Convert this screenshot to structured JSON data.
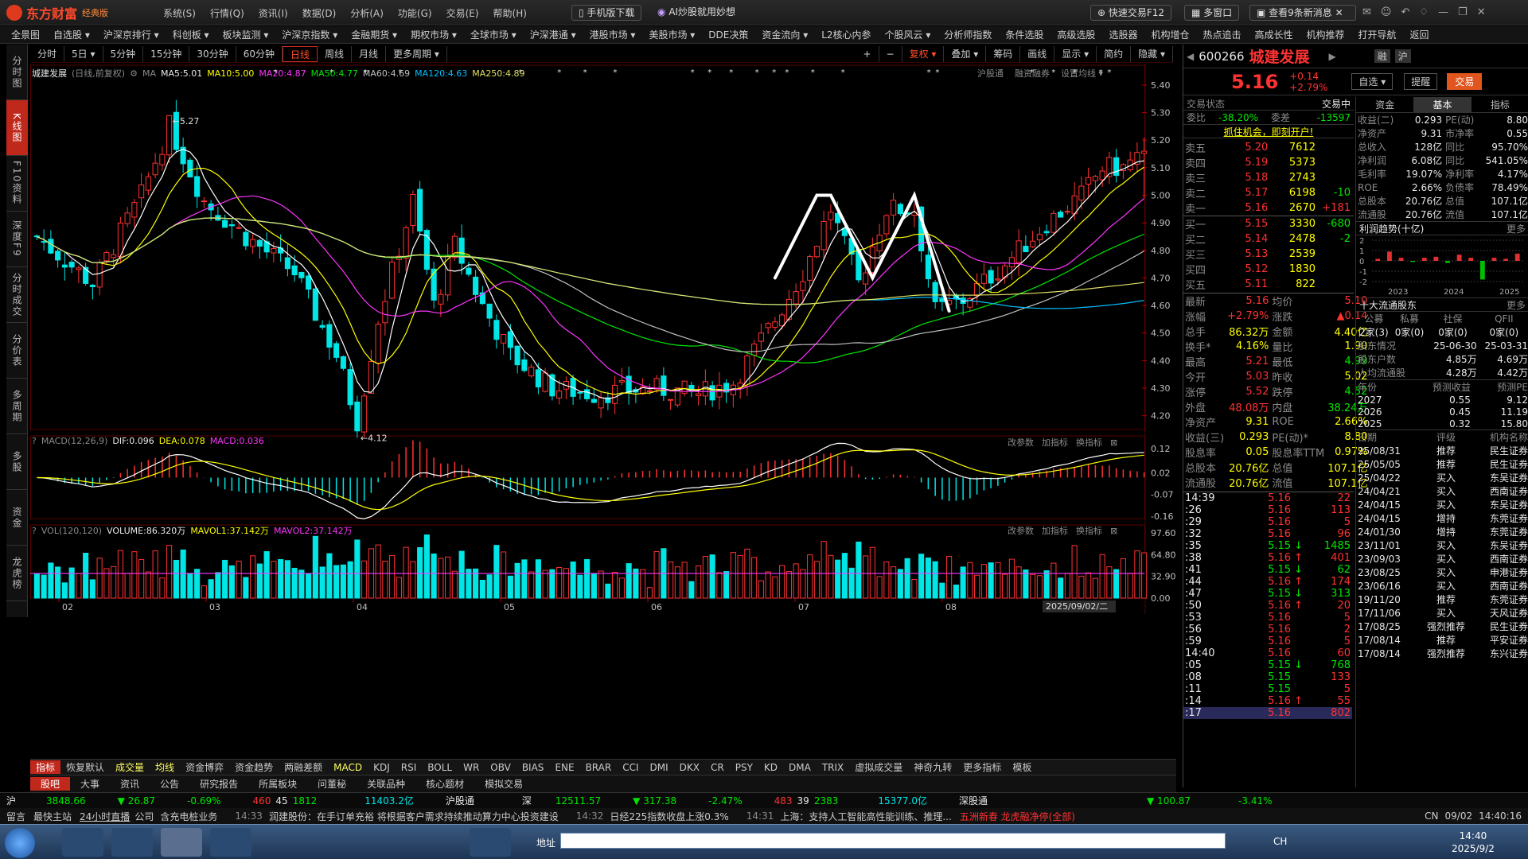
{
  "app": {
    "logo": "东方财富",
    "edition": "经典版"
  },
  "menus": [
    "系统(S)",
    "行情(Q)",
    "资讯(I)",
    "数据(D)",
    "分析(A)",
    "功能(G)",
    "交易(E)",
    "帮助(H)"
  ],
  "toolbar": {
    "mobile": "手机版下载",
    "ai": "AI炒股就用妙想",
    "quick_trade": "快速交易F12",
    "multi_window": "多窗口",
    "messages": "查看9条新消息",
    "msg_badge": "9"
  },
  "nav": [
    "全景图",
    "自选股 ▾",
    "沪深京排行 ▾",
    "科创板 ▾",
    "板块监测 ▾",
    "沪深京指数 ▾",
    "金融期货 ▾",
    "期权市场 ▾",
    "全球市场 ▾",
    "沪深港通 ▾",
    "港股市场 ▾",
    "美股市场 ▾",
    "DDE决策",
    "资金流向 ▾",
    "L2核心内参",
    "个股风云 ▾",
    "分析师指数",
    "条件选股",
    "高级选股",
    "选股器",
    "机构增仓",
    "热点追击",
    "高成长性",
    "机构推荐",
    "打开导航",
    "返回"
  ],
  "left_tabs": [
    "分时图",
    "K线图",
    "F10资料",
    "深度F9",
    "分时成交",
    "分价表",
    "多周期",
    "多股",
    "资金",
    "龙虎榜"
  ],
  "periods": [
    "分时",
    "5日 ▾",
    "5分钟",
    "15分钟",
    "30分钟",
    "60分钟",
    "日线",
    "周线",
    "月线",
    "更多周期 ▾"
  ],
  "period_active": "日线",
  "chart_tools": [
    "+",
    "−",
    "复权 ▾",
    "叠加 ▾",
    "筹码",
    "画线",
    "显示 ▾",
    "简约",
    "隐藏 ▾"
  ],
  "chart_tool_active": "复权 ▾",
  "kline_header": {
    "name": "城建发展",
    "mode": "(日线,前复权)",
    "ma_tag": "MA",
    "ma5": "MA5:5.01",
    "ma10": "MA10:5.00",
    "ma20": "MA20:4.87",
    "ma50": "MA50:4.77",
    "ma60": "MA60:4.69",
    "ma120": "MA120:4.63",
    "ma250": "MA250:4.89",
    "link1": "沪股通",
    "link2": "融资融券",
    "link3": "设置均线 ▾"
  },
  "markers": {
    "high": "5.27",
    "low": "4.12",
    "date_tag": "2025/09/02/二"
  },
  "x_labels": [
    "02",
    "03",
    "04",
    "05",
    "06",
    "07",
    "08"
  ],
  "price_axis": [
    "5.40",
    "5.30",
    "5.20",
    "5.10",
    "5.00",
    "4.90",
    "4.80",
    "4.70",
    "4.60",
    "4.50",
    "4.40",
    "4.30",
    "4.20"
  ],
  "macd_header": {
    "title": "MACD(12,26,9)",
    "dif": "DIF:0.096",
    "dea": "DEA:0.078",
    "macd": "MACD:0.036",
    "btn1": "改参数",
    "btn2": "加指标",
    "btn3": "换指标"
  },
  "macd_axis": [
    "0.12",
    "0.02",
    "-0.07",
    "-0.16"
  ],
  "vol_header": {
    "title": "VOL(120,120)",
    "volume": "VOLUME:86.320万",
    "mavol1": "MAVOL1:37.142万",
    "mavol2": "MAVOL2:37.142万",
    "btn1": "改参数",
    "btn2": "加指标",
    "btn3": "换指标"
  },
  "vol_axis": [
    "97.60",
    "64.80",
    "32.90",
    "0.00"
  ],
  "indicator_tabs": [
    "指标",
    "恢复默认",
    "成交量",
    "均线",
    "资金博弈",
    "资金趋势",
    "两融差额",
    "MACD",
    "KDJ",
    "RSI",
    "BOLL",
    "WR",
    "OBV",
    "BIAS",
    "ENE",
    "BRAR",
    "CCI",
    "DMI",
    "DKX",
    "CR",
    "PSY",
    "KD",
    "DMA",
    "TRIX",
    "虚拟成交量",
    "神奇九转",
    "更多指标",
    "模板"
  ],
  "news_tabs": [
    "股吧",
    "大事",
    "资讯",
    "公告",
    "研究报告",
    "所属板块",
    "问董秘",
    "关联品种",
    "核心题材",
    "模拟交易"
  ],
  "quote": {
    "code": "600266",
    "name": "城建发展",
    "price": "5.16",
    "change": "+0.14",
    "change_pct": "+2.79%",
    "rong": "融",
    "hu": "沪",
    "zixuan": "自选 ▾",
    "tixing": "提醒",
    "jiaoyi": "交易"
  },
  "trade_state": {
    "label": "交易状态",
    "value": "交易中",
    "weibi_label": "委比",
    "weibi": "-38.20%",
    "weicha_label": "委差",
    "weicha": "-13597",
    "promo": "抓住机会，即刻开户!"
  },
  "asks": [
    {
      "l": "卖五",
      "p": "5.20",
      "v": "7612",
      "c": ""
    },
    {
      "l": "卖四",
      "p": "5.19",
      "v": "5373",
      "c": ""
    },
    {
      "l": "卖三",
      "p": "5.18",
      "v": "2743",
      "c": ""
    },
    {
      "l": "卖二",
      "p": "5.17",
      "v": "6198",
      "c": "-10"
    },
    {
      "l": "卖一",
      "p": "5.16",
      "v": "2670",
      "c": "+181"
    }
  ],
  "bids": [
    {
      "l": "买一",
      "p": "5.15",
      "v": "3330",
      "c": "-680"
    },
    {
      "l": "买二",
      "p": "5.14",
      "v": "2478",
      "c": "-2"
    },
    {
      "l": "买三",
      "p": "5.13",
      "v": "2539",
      "c": ""
    },
    {
      "l": "买四",
      "p": "5.12",
      "v": "1830",
      "c": ""
    },
    {
      "l": "买五",
      "p": "5.11",
      "v": "822",
      "c": ""
    }
  ],
  "stats": [
    [
      "最新",
      "5.16",
      "均价",
      "5.10"
    ],
    [
      "涨幅",
      "+2.79%",
      "涨跌",
      "▲0.14"
    ],
    [
      "总手",
      "86.32万",
      "金额",
      "4.40亿"
    ],
    [
      "换手*",
      "4.16%",
      "量比",
      "1.90"
    ],
    [
      "最高",
      "5.21",
      "最低",
      "4.99"
    ],
    [
      "今开",
      "5.03",
      "昨收",
      "5.02"
    ],
    [
      "涨停",
      "5.52",
      "跌停",
      "4.52"
    ],
    [
      "外盘",
      "48.08万",
      "内盘",
      "38.24万"
    ],
    [
      "净资产",
      "9.31",
      "ROE",
      "2.66%"
    ],
    [
      "收益(三)",
      "0.293",
      "PE(动)*",
      "8.80"
    ],
    [
      "股息率",
      "0.05",
      "股息率TTM",
      "0.97%"
    ],
    [
      "总股本",
      "20.76亿",
      "总值",
      "107.1亿"
    ],
    [
      "流通股",
      "20.76亿",
      "流值",
      "107.1亿"
    ]
  ],
  "ticks": [
    [
      "14:39",
      "5.16",
      "22",
      ""
    ],
    [
      ":26",
      "5.16",
      "113",
      ""
    ],
    [
      ":29",
      "5.16",
      "5",
      ""
    ],
    [
      ":32",
      "5.16",
      "96",
      ""
    ],
    [
      ":35",
      "5.15",
      "1485",
      "d"
    ],
    [
      ":38",
      "5.16",
      "401",
      "u"
    ],
    [
      ":41",
      "5.15",
      "62",
      "d"
    ],
    [
      ":44",
      "5.16",
      "174",
      "u"
    ],
    [
      ":47",
      "5.15",
      "313",
      "d"
    ],
    [
      ":50",
      "5.16",
      "20",
      "u"
    ],
    [
      ":53",
      "5.16",
      "5",
      ""
    ],
    [
      ":56",
      "5.16",
      "2",
      ""
    ],
    [
      ":59",
      "5.16",
      "5",
      ""
    ],
    [
      "14:40",
      "5.16",
      "60",
      ""
    ],
    [
      ":05",
      "5.15",
      "768",
      "d"
    ],
    [
      ":08",
      "5.15",
      "133",
      ""
    ],
    [
      ":11",
      "5.15",
      "5",
      ""
    ],
    [
      ":14",
      "5.16",
      "55",
      "u"
    ],
    [
      ":17",
      "5.16",
      "802",
      ""
    ]
  ],
  "tick_tabs": [
    "分笔",
    "分价",
    "分时",
    "异动"
  ],
  "fund_tabs": [
    "资金",
    "基本",
    "指标"
  ],
  "fund": [
    [
      "收益(二)",
      "0.293",
      "PE(动)",
      "8.80"
    ],
    [
      "净资产",
      "9.31",
      "市净率",
      "0.55"
    ],
    [
      "总收入",
      "128亿",
      "同比",
      "95.70%"
    ],
    [
      "净利润",
      "6.08亿",
      "同比",
      "541.05%"
    ],
    [
      "毛利率",
      "19.07%",
      "净利率",
      "4.17%"
    ],
    [
      "ROE",
      "2.66%",
      "负债率",
      "78.49%"
    ],
    [
      "总股本",
      "20.76亿",
      "总值",
      "107.1亿"
    ],
    [
      "流通股",
      "20.76亿",
      "流值",
      "107.1亿"
    ]
  ],
  "profit": {
    "title": "利润趋势(十亿)",
    "more": "更多",
    "axis": [
      "2",
      "1",
      "0",
      "-1",
      "-2"
    ],
    "years": [
      "2023",
      "2024",
      "2025"
    ],
    "values": [
      0.2,
      0.9,
      0.3,
      -0.1,
      0.3,
      0.4,
      -0.2,
      0.6,
      0.3,
      -1.8,
      0.3,
      0.2,
      0.7
    ]
  },
  "holders": {
    "title": "十大流通股东",
    "more": "更多",
    "heads": [
      "公募",
      "私募",
      "社保",
      "QFII"
    ],
    "counts": [
      "2家(3)",
      "0家(0)",
      "0家(0)",
      "0家(0)"
    ],
    "rows": [
      [
        "股东情况",
        "25-06-30",
        "25-03-31"
      ],
      [
        "股东户数",
        "4.85万",
        "4.69万"
      ],
      [
        "人均流通股",
        "4.28万",
        "4.42万"
      ]
    ]
  },
  "forecast": {
    "heads": [
      "年份",
      "预测收益",
      "预测PE"
    ],
    "rows": [
      [
        "2027",
        "0.55",
        "9.12"
      ],
      [
        "2026",
        "0.45",
        "11.19"
      ],
      [
        "2025",
        "0.32",
        "15.80"
      ]
    ]
  },
  "ratings": {
    "heads": [
      "日期",
      "评级",
      "机构名称"
    ],
    "rows": [
      [
        "25/08/31",
        "推荐",
        "民生证券"
      ],
      [
        "25/05/05",
        "推荐",
        "民生证券"
      ],
      [
        "25/04/22",
        "买入",
        "东吴证券"
      ],
      [
        "24/04/21",
        "买入",
        "西南证券"
      ],
      [
        "24/04/15",
        "买入",
        "东吴证券"
      ],
      [
        "24/04/15",
        "增持",
        "东莞证券"
      ],
      [
        "24/01/30",
        "增持",
        "东莞证券"
      ],
      [
        "23/11/01",
        "买入",
        "东吴证券"
      ],
      [
        "23/09/03",
        "买入",
        "西南证券"
      ],
      [
        "23/08/25",
        "买入",
        "申港证券"
      ],
      [
        "23/06/16",
        "买入",
        "西南证券"
      ],
      [
        "19/11/20",
        "推荐",
        "东莞证券"
      ],
      [
        "17/11/06",
        "买入",
        "天风证券"
      ],
      [
        "17/08/25",
        "强烈推荐",
        "民生证券"
      ],
      [
        "17/08/14",
        "推荐",
        "平安证券"
      ],
      [
        "17/08/14",
        "强烈推荐",
        "东兴证券"
      ]
    ]
  },
  "status": {
    "sh_label": "沪",
    "sh_idx": "3848.66",
    "sh_chg": "▼ 26.87",
    "sh_pct": "-0.69%",
    "sh_up": "460",
    "sh_flat": "45",
    "sh_down": "1812",
    "sh_amt": "11403.2亿",
    "hgt": "沪股通",
    "sz_label": "深",
    "sz_idx": "12511.57",
    "sz_chg": "▼ 317.38",
    "sz_pct": "-2.47%",
    "sz_up": "483",
    "sz_flat": "39",
    "sz_down": "2383",
    "sz_amt": "15377.0亿",
    "sgt": "深股通",
    "right_chg": "▼ 100.87",
    "right_pct": "-3.41%"
  },
  "ticker": {
    "t1": "留言",
    "t2": "最快主站",
    "t3": "24小时直播",
    "t4": "公司",
    "n1": "含充电桩业务",
    "n2time": "14:33",
    "n2": "润建股份：在手订单充裕 将根据客户需求持续推动算力中心投资建设",
    "n3time": "14:32",
    "n3": "日经225指数收盘上涨0.3%",
    "n4time": "14:31",
    "n4": "上海：支持人工智能高性能训练、推理...",
    "alert": "五洲新春  龙虎融净停(全部)",
    "lang": "CN",
    "date": "09/02",
    "time": "14:40:16"
  },
  "taskbar": {
    "addr_label": "地址",
    "clock_time": "14:40",
    "clock_date": "2025/9/2",
    "lang": "CH"
  },
  "colors": {
    "up": "#ff3232",
    "down": "#00e5e5",
    "ma5": "#ffffff",
    "ma10": "#ffff00",
    "ma20": "#ff33ff",
    "ma50": "#00e600",
    "ma60": "#c0c0c0",
    "ma120": "#00bfff",
    "ma250": "#e0e060",
    "accent": "#c0281c"
  }
}
